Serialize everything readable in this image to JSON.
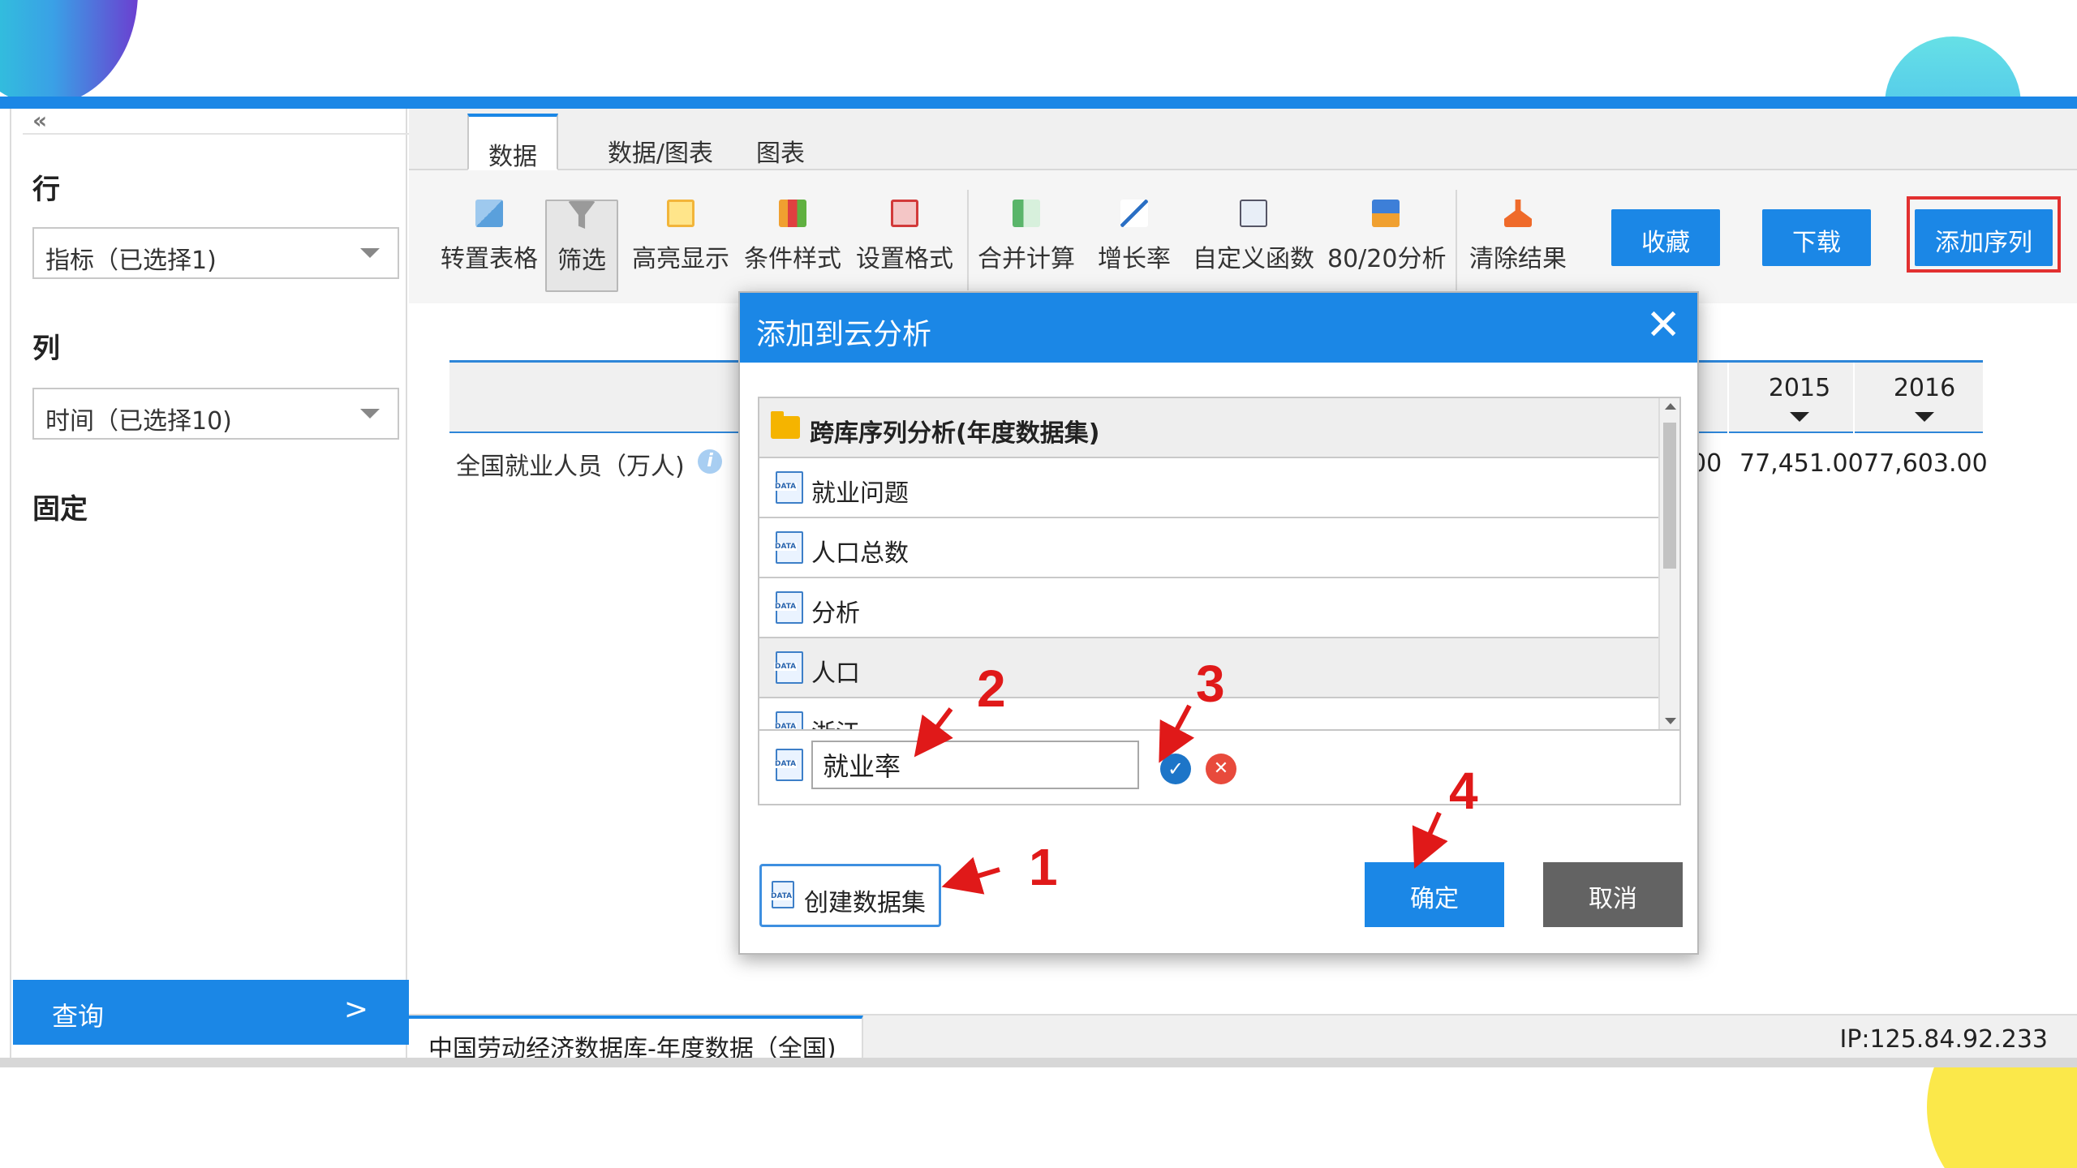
{
  "colors": {
    "accent": "#1b87e6",
    "highlight": "#e23030",
    "annotation": "#e01919",
    "cancel": "#636363"
  },
  "left_panel": {
    "row_label": "行",
    "row_select": "指标（已选择1)",
    "col_label": "列",
    "col_select": "时间（已选择10)",
    "fixed_label": "固定",
    "query_label": "查询",
    "query_arrow": ">"
  },
  "tabs": [
    {
      "label": "数据"
    },
    {
      "label": "数据/图表"
    },
    {
      "label": "图表"
    }
  ],
  "toolbar": {
    "items": [
      {
        "label": "转置表格",
        "icon": "transpose-icon"
      },
      {
        "label": "筛选",
        "icon": "filter-icon"
      },
      {
        "label": "高亮显示",
        "icon": "highlight-icon"
      },
      {
        "label": "条件样式",
        "icon": "condition-style-icon"
      },
      {
        "label": "设置格式",
        "icon": "format-icon"
      },
      {
        "label": "合并计算",
        "icon": "merge-icon"
      },
      {
        "label": "增长率",
        "icon": "growth-icon"
      },
      {
        "label": "自定义函数",
        "icon": "function-icon"
      },
      {
        "label": "80/20分析",
        "icon": "pareto-icon"
      },
      {
        "label": "清除结果",
        "icon": "clear-icon"
      }
    ],
    "favorite_label": "收藏",
    "download_label": "下载",
    "add_series_label": "添加序列"
  },
  "table": {
    "year_cols": [
      "2015",
      "2016"
    ],
    "row_label": "全国就业人员（万人)",
    "info_icon": "i",
    "partial_value": "00",
    "values": [
      "77,451.00",
      "77,603.00"
    ]
  },
  "status_bar": {
    "tab_label": "中国劳动经济数据库-年度数据（全国)",
    "ip": "IP:125.84.92.233"
  },
  "dialog": {
    "title": "添加到云分析",
    "close": "✕",
    "folder": "跨库序列分析(年度数据集)",
    "items": [
      "就业问题",
      "人口总数",
      "分析",
      "人口",
      "浙江"
    ],
    "input_value": "就业率",
    "confirm_icon": "✓",
    "cancel_icon": "✕",
    "create_label": "创建数据集",
    "ok_label": "确定",
    "cancel_label": "取消"
  },
  "annotations": [
    "1",
    "2",
    "3",
    "4"
  ],
  "collapse_glyph": "«"
}
